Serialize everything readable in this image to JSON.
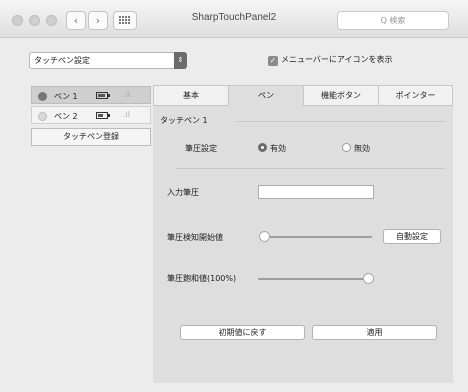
{
  "window": {
    "title": "SharpTouchPanel2",
    "nav_back": "‹",
    "nav_forward": "›",
    "grid_icon": "grid-icon",
    "search_placeholder": "Q 検索"
  },
  "top": {
    "dropdown_value": "タッチペン設定",
    "show_menu_icon_checked": true,
    "show_menu_icon_label": "メニューバーにアイコンを表示"
  },
  "pens": [
    {
      "name": "ペン 1",
      "battery_level": 0.75,
      "signal": ".ıl"
    },
    {
      "name": "ペン 2",
      "battery_level": 0.6,
      "signal": ".ıl"
    }
  ],
  "register_button": "タッチペン登録",
  "tabs": [
    {
      "label": "基本",
      "active": false
    },
    {
      "label": "ペン",
      "active": true
    },
    {
      "label": "機能ボタン",
      "active": false
    },
    {
      "label": "ポインター",
      "active": false
    }
  ],
  "pen_settings": {
    "section_title": "タッチペン 1",
    "pressure_setting_label": "筆圧設定",
    "pressure_on_label": "有効",
    "pressure_off_label": "無効",
    "pressure_enabled": true,
    "input_pressure_label": "入力筆圧",
    "input_pressure_value": "",
    "detect_start_label": "筆圧検知開始値",
    "detect_start_level": 0.0,
    "auto_button": "自動設定",
    "saturation_label": "筆圧飽和値(100%)",
    "saturation_level": 1.0,
    "reset_button": "初期値に戻す",
    "apply_button": "適用"
  },
  "colors": {
    "accent_gray": "#6a6a6a",
    "panel_bg": "#dedede"
  }
}
